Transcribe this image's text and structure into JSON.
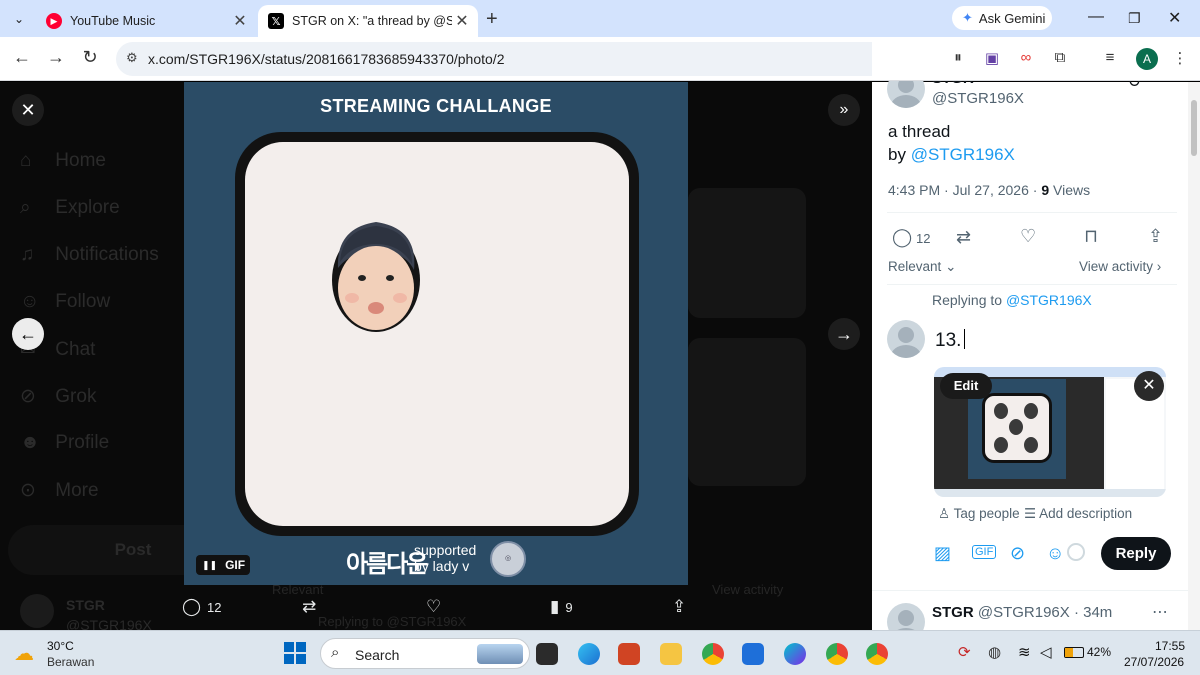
{
  "browser": {
    "tabs": [
      {
        "title": "YouTube Music"
      },
      {
        "title": "STGR on X: \"a thread by @STGR"
      }
    ],
    "ask_gemini": "Ask Gemini",
    "url": "x.com/STGR196X/status/2081661783685943370/photo/2",
    "profile_initial": "A"
  },
  "bg_nav": [
    {
      "label": "Home"
    },
    {
      "label": "Explore"
    },
    {
      "label": "Notifications"
    },
    {
      "label": "Follow"
    },
    {
      "label": "Chat"
    },
    {
      "label": "Grok"
    },
    {
      "label": "Profile"
    },
    {
      "label": "More"
    }
  ],
  "bg_post_label": "Post",
  "bg_user": {
    "name": "STGR",
    "handle": "@STGR196X"
  },
  "bg_texts": {
    "relevant": "Relevant",
    "view_activity": "View activity",
    "replying": "Replying to @STGR196X"
  },
  "media": {
    "title": "STREAMING CHALLANGE",
    "gif_label": "GIF",
    "logo_text": "아름다운",
    "supported_line1": "supported",
    "supported_line2": "by lady v"
  },
  "media_actions": {
    "replies": "12",
    "views": "9"
  },
  "post": {
    "author_name": "STGR",
    "handle": "@STGR196X",
    "text_line1": "a thread",
    "text_by": "by",
    "text_mention": "@STGR196X",
    "timestamp": "4:43 PM · Jul 27, 2026 · ",
    "views_count": "9",
    "views_label": " Views",
    "reply_count": "12",
    "relevant": "Relevant",
    "view_activity": "View activity"
  },
  "composer": {
    "replying_prefix": "Replying to ",
    "replying_handle": "@STGR196X",
    "text": "13.",
    "edit": "Edit",
    "tag_people": "Tag people",
    "add_description": "Add description",
    "reply_button": "Reply"
  },
  "reply": {
    "name": "STGR",
    "handle": "@STGR196X",
    "time": "34m"
  },
  "taskbar": {
    "temp": "30°C",
    "weather": "Berawan",
    "search": "Search",
    "battery": "42%",
    "time": "17:55",
    "date": "27/07/2026"
  }
}
